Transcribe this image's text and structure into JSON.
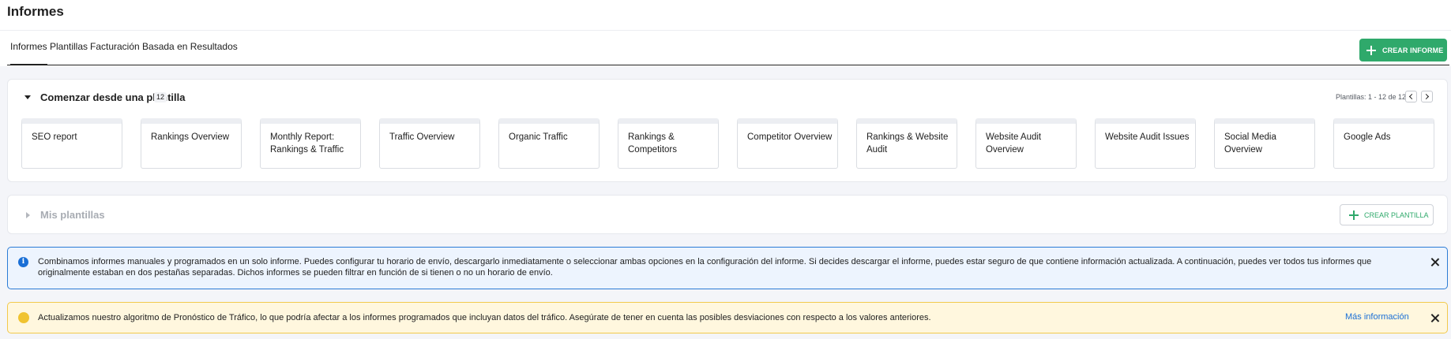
{
  "header": {
    "title": "Informes"
  },
  "tabs": [
    {
      "label": "Informes",
      "active": true
    },
    {
      "label": "Plantillas",
      "active": false
    },
    {
      "label": "Facturación Basada en Resultados",
      "active": false
    }
  ],
  "create_report_button": {
    "label": "CREAR INFORME",
    "icon": "plus-icon"
  },
  "templates_section": {
    "title": "Comenzar desde una plantilla",
    "count": "12",
    "pagination_label": "Plantillas: 1 - 12 de 12",
    "cards": [
      {
        "label": "SEO report"
      },
      {
        "label": "Rankings Overview"
      },
      {
        "label": "Monthly Report: Rankings & Traffic"
      },
      {
        "label": "Traffic Overview"
      },
      {
        "label": "Organic Traffic"
      },
      {
        "label": "Rankings & Competitors"
      },
      {
        "label": "Competitor Overview"
      },
      {
        "label": "Rankings & Website Audit"
      },
      {
        "label": "Website Audit Overview"
      },
      {
        "label": "Website Audit Issues"
      },
      {
        "label": "Social Media Overview"
      },
      {
        "label": "Google Ads"
      }
    ]
  },
  "my_templates": {
    "title": "Mis plantillas",
    "create_button": {
      "label": "CREAR PLANTILLA",
      "icon": "plus-icon"
    }
  },
  "info_alert": {
    "icon": "info-icon",
    "text": "Combinamos informes manuales y programados en un solo informe. Puedes configurar tu horario de envío, descargarlo inmediatamente o seleccionar ambas opciones en la configuración del informe. Si decides descargar el informe, puedes estar seguro de que contiene información actualizada. A continuación, puedes ver todos tus informes que originalmente estaban en dos pestañas separadas. Dichos informes se pueden filtrar en función de si tienen o no un horario de envío."
  },
  "warning_alert": {
    "icon": "warning-dot-icon",
    "text": "Actualizamos nuestro algoritmo de Pronóstico de Tráfico, lo que podría afectar a los informes programados que incluyan datos del tráfico. Asegúrate de tener en cuenta las posibles desviaciones con respecto a los valores anteriores.",
    "link": "Más información"
  },
  "colors": {
    "primary_green": "#2fa96b",
    "info_blue": "#2b7bd5",
    "warning_yellow": "#f2c94c",
    "link_blue": "#1a6fd6"
  }
}
